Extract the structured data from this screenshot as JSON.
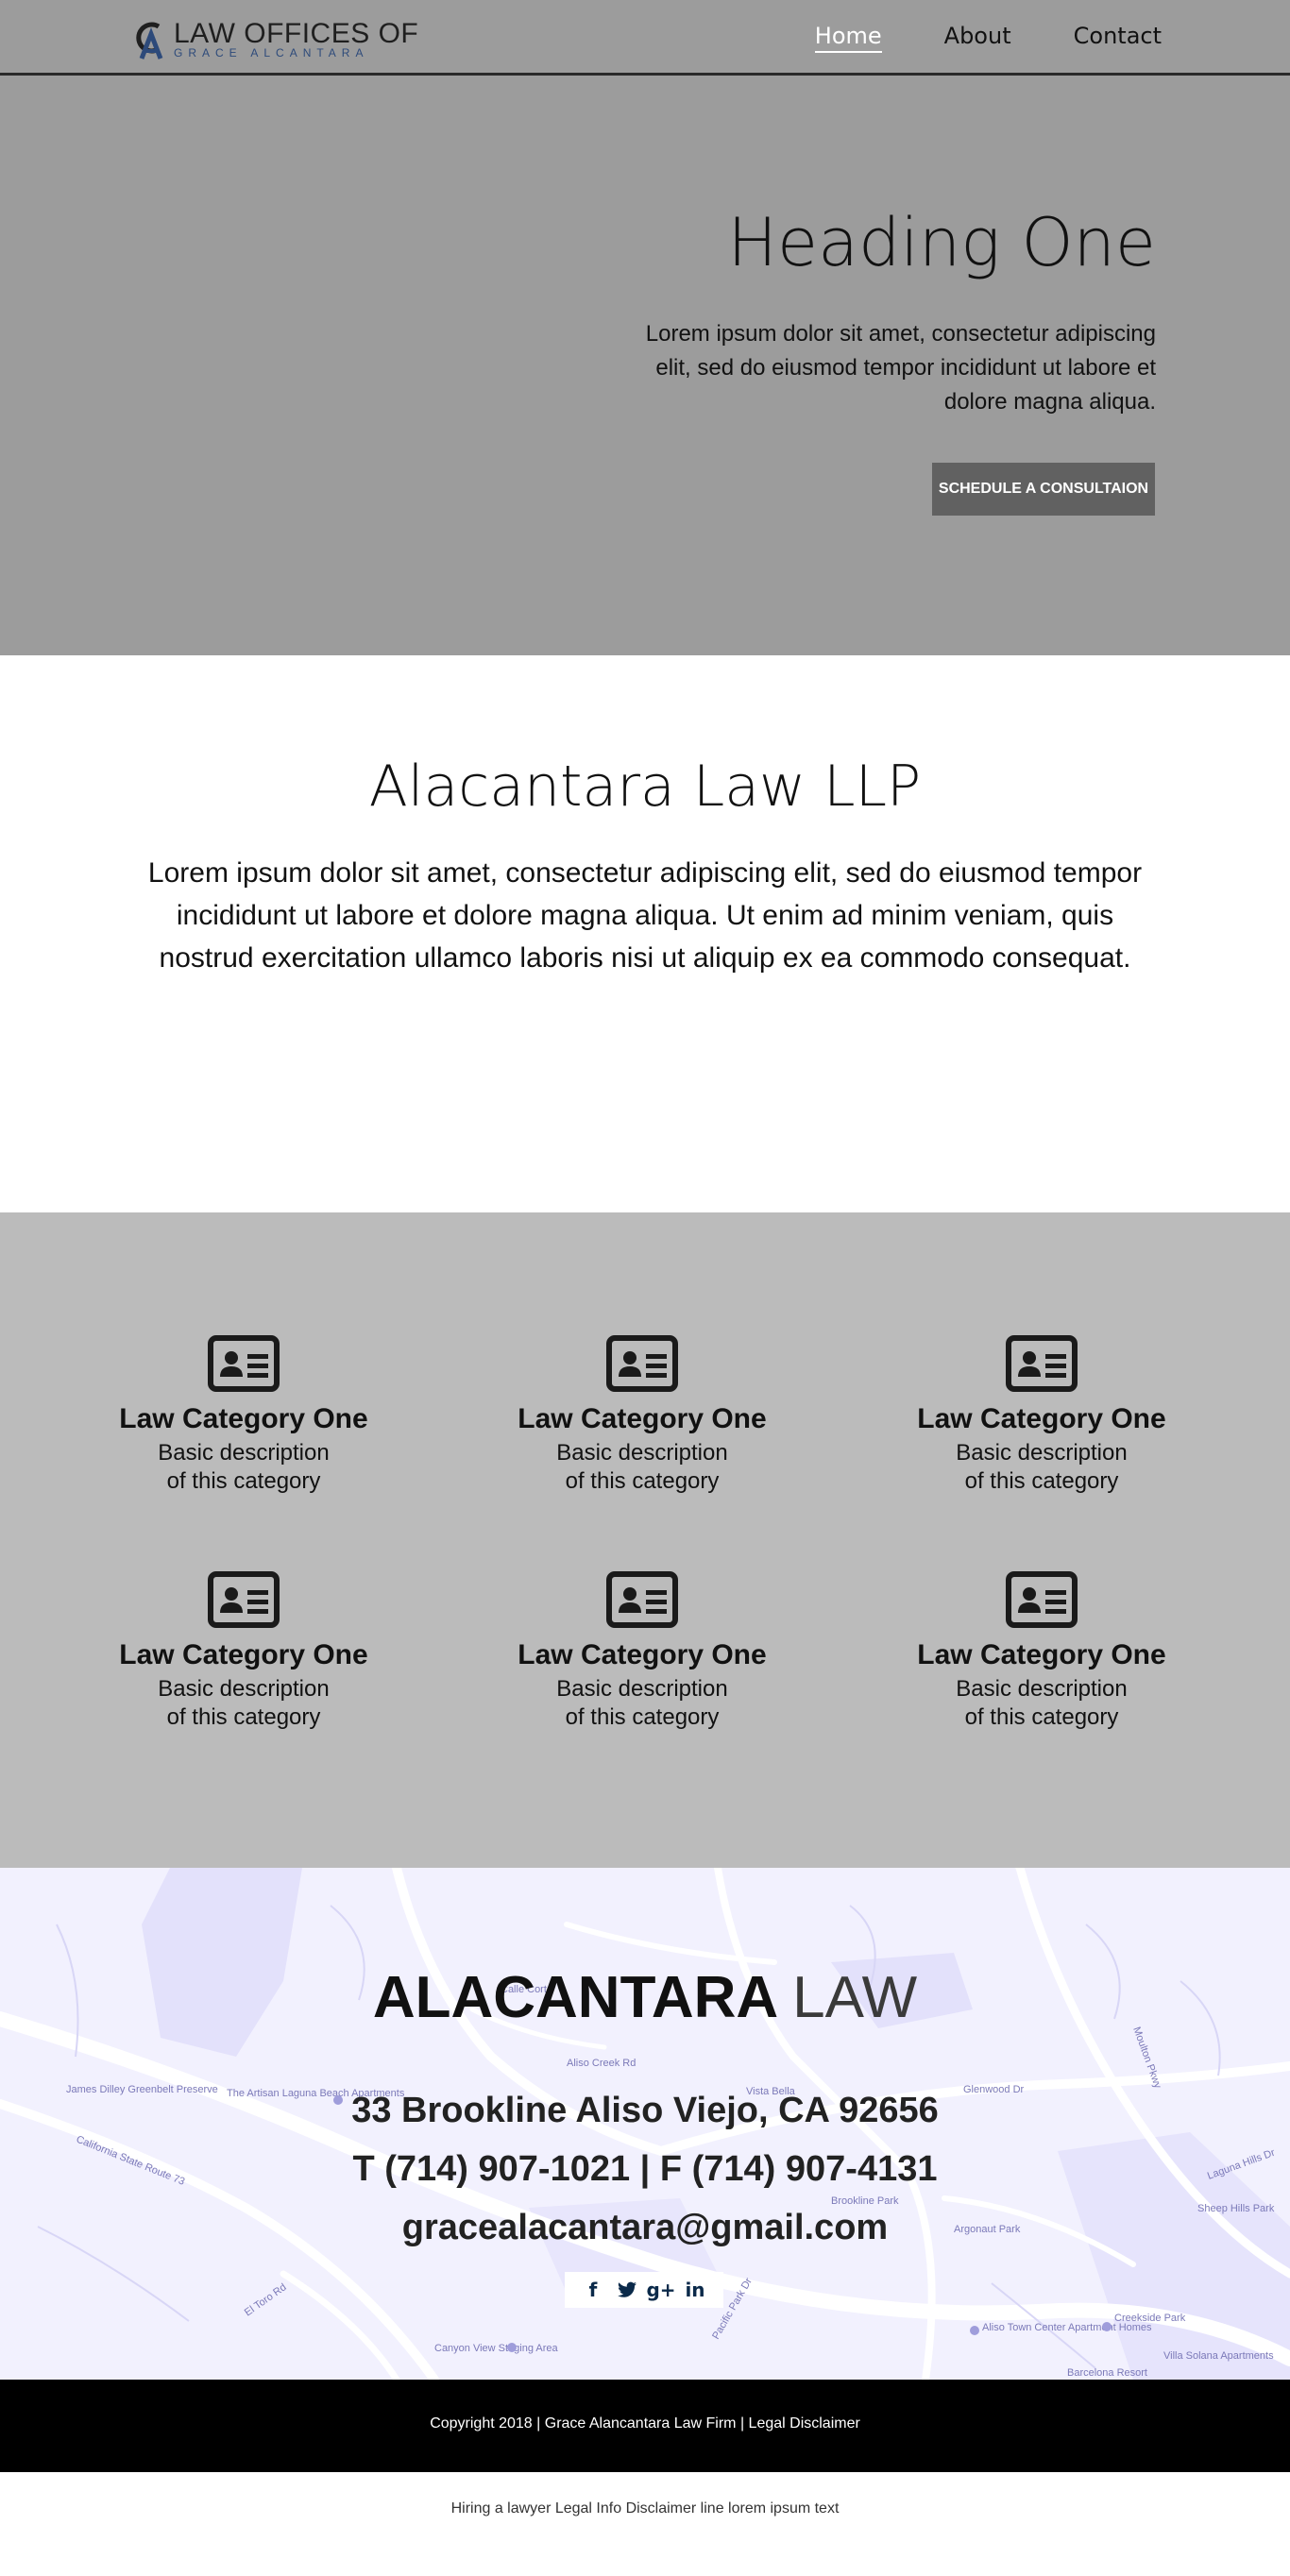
{
  "header": {
    "logo": {
      "title": "LAW OFFICES OF",
      "subtitle": "GRACE ALCANTARA"
    },
    "nav": [
      {
        "label": "Home",
        "active": true
      },
      {
        "label": "About",
        "active": false
      },
      {
        "label": "Contact",
        "active": false
      }
    ]
  },
  "hero": {
    "heading": "Heading One",
    "body": "Lorem ipsum dolor sit amet, consectetur adipiscing elit, sed do eiusmod tempor incididunt ut labore et dolore magna aliqua.",
    "button_label": "SCHEDULE A CONSULTAION"
  },
  "about": {
    "title": "Alacantara Law LLP",
    "body": "Lorem ipsum dolor sit amet, consectetur adipiscing elit, sed do eiusmod tempor incididunt ut labore et dolore magna aliqua. Ut enim ad minim veniam, quis nostrud exercitation ullamco laboris nisi ut aliquip ex ea commodo consequat."
  },
  "categories": [
    {
      "title": "Law Category One",
      "desc1": "Basic description",
      "desc2": "of this category",
      "icon": "id-card-icon"
    },
    {
      "title": "Law Category One",
      "desc1": "Basic description",
      "desc2": "of this category",
      "icon": "id-card-icon"
    },
    {
      "title": "Law Category One",
      "desc1": "Basic description",
      "desc2": "of this category",
      "icon": "id-card-icon"
    },
    {
      "title": "Law Category One",
      "desc1": "Basic description",
      "desc2": "of this category",
      "icon": "id-card-icon"
    },
    {
      "title": "Law Category One",
      "desc1": "Basic description",
      "desc2": "of this category",
      "icon": "id-card-icon"
    },
    {
      "title": "Law Category One",
      "desc1": "Basic description",
      "desc2": "of this category",
      "icon": "id-card-icon"
    }
  ],
  "contact": {
    "brand_bold": "ALACANTARA",
    "brand_light": "LAW",
    "address": "33 Brookline Aliso Viejo, CA 92656",
    "phone": "T (714) 907-1021 | F (714) 907-4131",
    "email": "gracealacantara@gmail.com",
    "social": [
      {
        "icon": "facebook-icon",
        "glyph": "f"
      },
      {
        "icon": "twitter-icon",
        "glyph": "❧"
      },
      {
        "icon": "google-plus-icon",
        "glyph": "g+"
      },
      {
        "icon": "linkedin-icon",
        "glyph": "in"
      }
    ],
    "map_labels": [
      "James Dilley Greenbelt Preserve",
      "The Artisan Laguna Beach Apartments",
      "California State Route 73",
      "Canyon View Staging Area",
      "El Toro Rd",
      "Aliso Creek Rd",
      "Glenwood Dr",
      "Vista Bella",
      "Brookline Park",
      "Argonaut Park",
      "Aliso Town Center Apartment Homes",
      "Creekside Park",
      "Barcelona Resort",
      "Sheep Hills Park",
      "Villa Solana Apartments",
      "Calle Corta",
      "Moulton Pkwy",
      "Laguna Hills Dr",
      "Pacific Park Dr"
    ]
  },
  "footer": {
    "copyright": "Copyright 2018 | Grace Alancantara Law Firm | Legal Disclaimer",
    "disclaimer": "Hiring a lawyer Legal Info Disclaimer line lorem ipsum text"
  },
  "colors": {
    "header_bg": "#9c9c9c",
    "categories_bg": "#bbbbbb",
    "button_bg": "#616161",
    "map_bg": "#f2f1fe",
    "logo_accent": "#2d4a7a",
    "social_icon": "#0b2a4a"
  }
}
